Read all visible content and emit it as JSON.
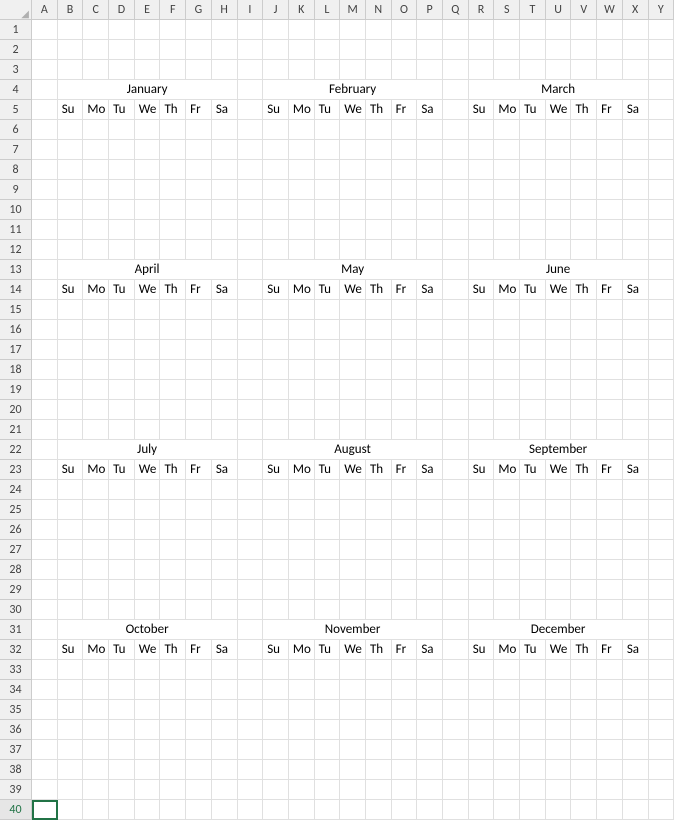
{
  "columns": [
    "A",
    "B",
    "C",
    "D",
    "E",
    "F",
    "G",
    "H",
    "I",
    "J",
    "K",
    "L",
    "M",
    "N",
    "O",
    "P",
    "Q",
    "R",
    "S",
    "T",
    "U",
    "V",
    "W",
    "X",
    "Y"
  ],
  "row_count": 40,
  "selected_row": 40,
  "months": [
    {
      "name": "January",
      "title_row": 4,
      "day_row": 5,
      "col_start": 2,
      "col_end": 8
    },
    {
      "name": "February",
      "title_row": 4,
      "day_row": 5,
      "col_start": 10,
      "col_end": 16
    },
    {
      "name": "March",
      "title_row": 4,
      "day_row": 5,
      "col_start": 18,
      "col_end": 24
    },
    {
      "name": "April",
      "title_row": 13,
      "day_row": 14,
      "col_start": 2,
      "col_end": 8
    },
    {
      "name": "May",
      "title_row": 13,
      "day_row": 14,
      "col_start": 10,
      "col_end": 16
    },
    {
      "name": "June",
      "title_row": 13,
      "day_row": 14,
      "col_start": 18,
      "col_end": 24
    },
    {
      "name": "July",
      "title_row": 22,
      "day_row": 23,
      "col_start": 2,
      "col_end": 8
    },
    {
      "name": "August",
      "title_row": 22,
      "day_row": 23,
      "col_start": 10,
      "col_end": 16
    },
    {
      "name": "September",
      "title_row": 22,
      "day_row": 23,
      "col_start": 18,
      "col_end": 24
    },
    {
      "name": "October",
      "title_row": 31,
      "day_row": 32,
      "col_start": 2,
      "col_end": 8
    },
    {
      "name": "November",
      "title_row": 31,
      "day_row": 32,
      "col_start": 10,
      "col_end": 16
    },
    {
      "name": "December",
      "title_row": 31,
      "day_row": 32,
      "col_start": 18,
      "col_end": 24
    }
  ],
  "weekdays": [
    "Su",
    "Mo",
    "Tu",
    "We",
    "Th",
    "Fr",
    "Sa"
  ]
}
